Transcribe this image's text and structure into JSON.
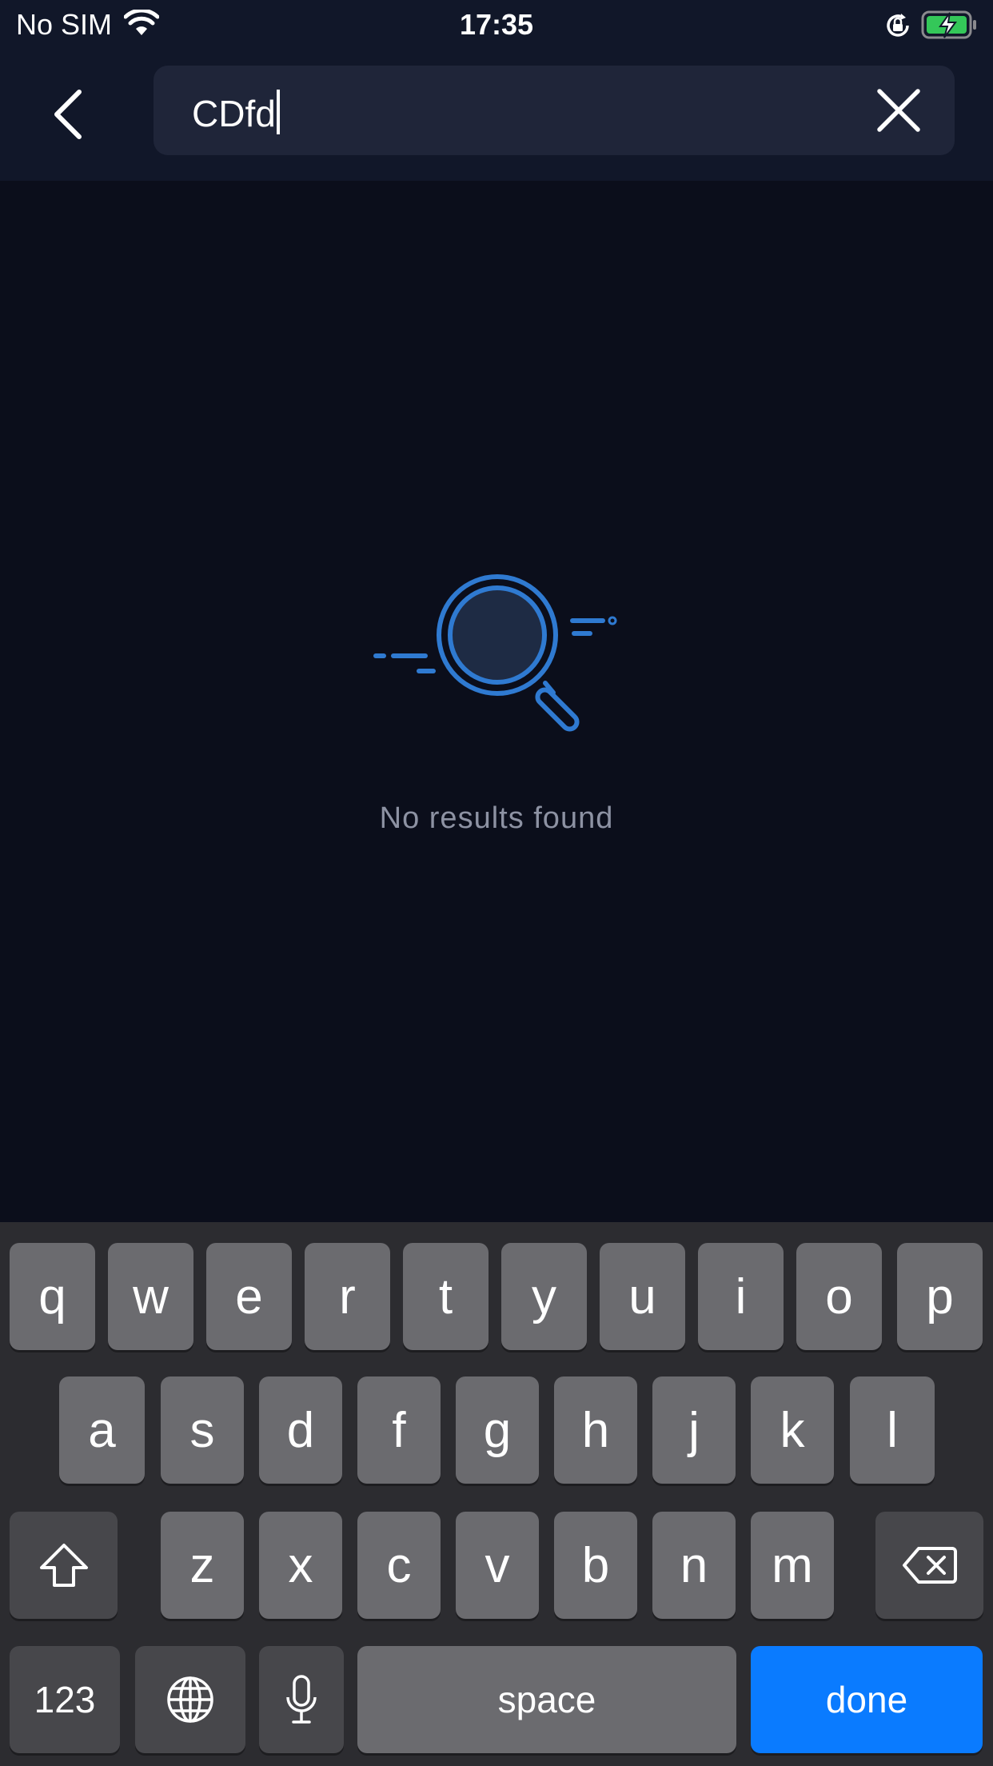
{
  "status_bar": {
    "carrier": "No SIM",
    "time": "17:35",
    "icons": [
      "wifi-icon",
      "orientation-lock-icon",
      "battery-charging-icon"
    ]
  },
  "header": {
    "back_icon": "chevron-left-icon",
    "search": {
      "value": "CDfd",
      "clear_icon": "close-icon"
    }
  },
  "empty_state": {
    "icon": "magnifier-illustration",
    "message": "No results found"
  },
  "keyboard": {
    "row1": [
      "q",
      "w",
      "e",
      "r",
      "t",
      "y",
      "u",
      "i",
      "o",
      "p"
    ],
    "row2": [
      "a",
      "s",
      "d",
      "f",
      "g",
      "h",
      "j",
      "k",
      "l"
    ],
    "row3": [
      "z",
      "x",
      "c",
      "v",
      "b",
      "n",
      "m"
    ],
    "shift_icon": "shift-icon",
    "backspace_icon": "backspace-icon",
    "numbers_label": "123",
    "globe_icon": "globe-icon",
    "mic_icon": "microphone-icon",
    "space_label": "space",
    "done_label": "done"
  },
  "colors": {
    "background": "#0b0e1b",
    "header": "#111729",
    "search_field": "#1f2539",
    "accent_blue": "#2f7ad1",
    "done_key": "#0a7bff",
    "empty_text": "#8d92a3"
  }
}
